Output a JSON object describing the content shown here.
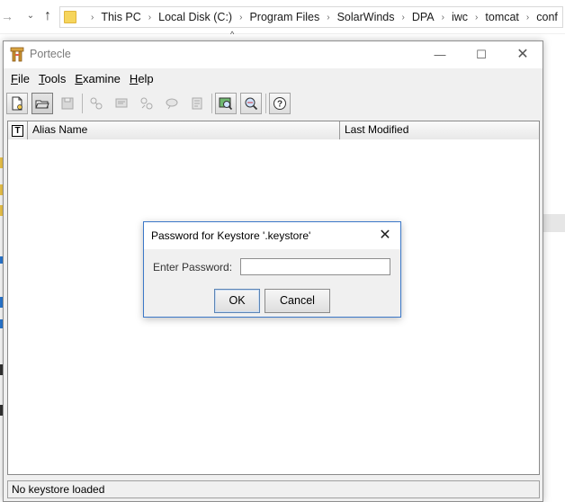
{
  "explorer": {
    "breadcrumbs": [
      "This PC",
      "Local Disk (C:)",
      "Program Files",
      "SolarWinds",
      "DPA",
      "iwc",
      "tomcat",
      "conf"
    ]
  },
  "window": {
    "title": "Portecle",
    "controls": {
      "minimize": "—",
      "maximize": "☐",
      "close": "✕"
    }
  },
  "menu": [
    {
      "accel": "F",
      "rest": "ile"
    },
    {
      "accel": "T",
      "rest": "ools"
    },
    {
      "accel": "E",
      "rest": "xamine"
    },
    {
      "accel": "H",
      "rest": "elp"
    }
  ],
  "toolbar": {
    "buttons": [
      {
        "name": "new-keystore-icon",
        "state": "enabled"
      },
      {
        "name": "open-keystore-icon",
        "state": "pressed"
      },
      {
        "name": "save-keystore-icon",
        "state": "disabled"
      },
      {
        "name": "generate-keypair-icon",
        "state": "disabled"
      },
      {
        "name": "import-certificate-icon",
        "state": "disabled"
      },
      {
        "name": "import-keypair-icon",
        "state": "disabled"
      },
      {
        "name": "set-password-icon",
        "state": "disabled"
      },
      {
        "name": "keystore-report-icon",
        "state": "disabled"
      },
      {
        "name": "examine-certificate-icon",
        "state": "enabled"
      },
      {
        "name": "examine-ssl-icon",
        "state": "enabled"
      },
      {
        "name": "help-icon",
        "state": "enabled"
      }
    ]
  },
  "table": {
    "type_header": "T",
    "columns": [
      "Alias Name",
      "Last Modified"
    ]
  },
  "status": {
    "text": "No keystore loaded"
  },
  "dialog": {
    "title": "Password for Keystore '.keystore'",
    "label": "Enter Password:",
    "password_value": "",
    "ok_label": "OK",
    "cancel_label": "Cancel",
    "close_glyph": "✕"
  }
}
